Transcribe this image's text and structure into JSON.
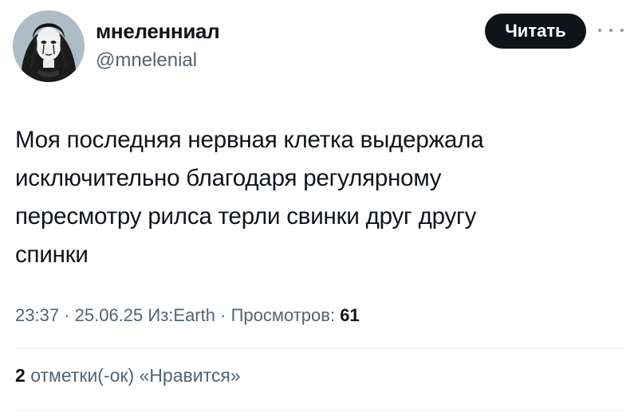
{
  "author": {
    "display_name": "мнеленниал",
    "handle": "@mnelenial",
    "avatar_icon": "avatar-portrait"
  },
  "follow_button": {
    "label": "Читать"
  },
  "more_icon": "ellipsis-icon",
  "tweet": {
    "text": "Моя последняя нервная клетка выдержала\nисключительно благодаря регулярному\nпересмотру рилса терли свинки друг другу\nспинки"
  },
  "meta": {
    "time": "23:37",
    "separator": " · ",
    "date": "25.06.25",
    "source": "Из:Earth",
    "views_label": "Просмотров:",
    "views_count": "61"
  },
  "likes": {
    "count": "2",
    "label": "отметки(-ок) «Нравится»"
  },
  "colors": {
    "text_primary": "#0f1419",
    "text_secondary": "#536471",
    "button_bg": "#0f1419",
    "divider": "#e6e9eb"
  }
}
